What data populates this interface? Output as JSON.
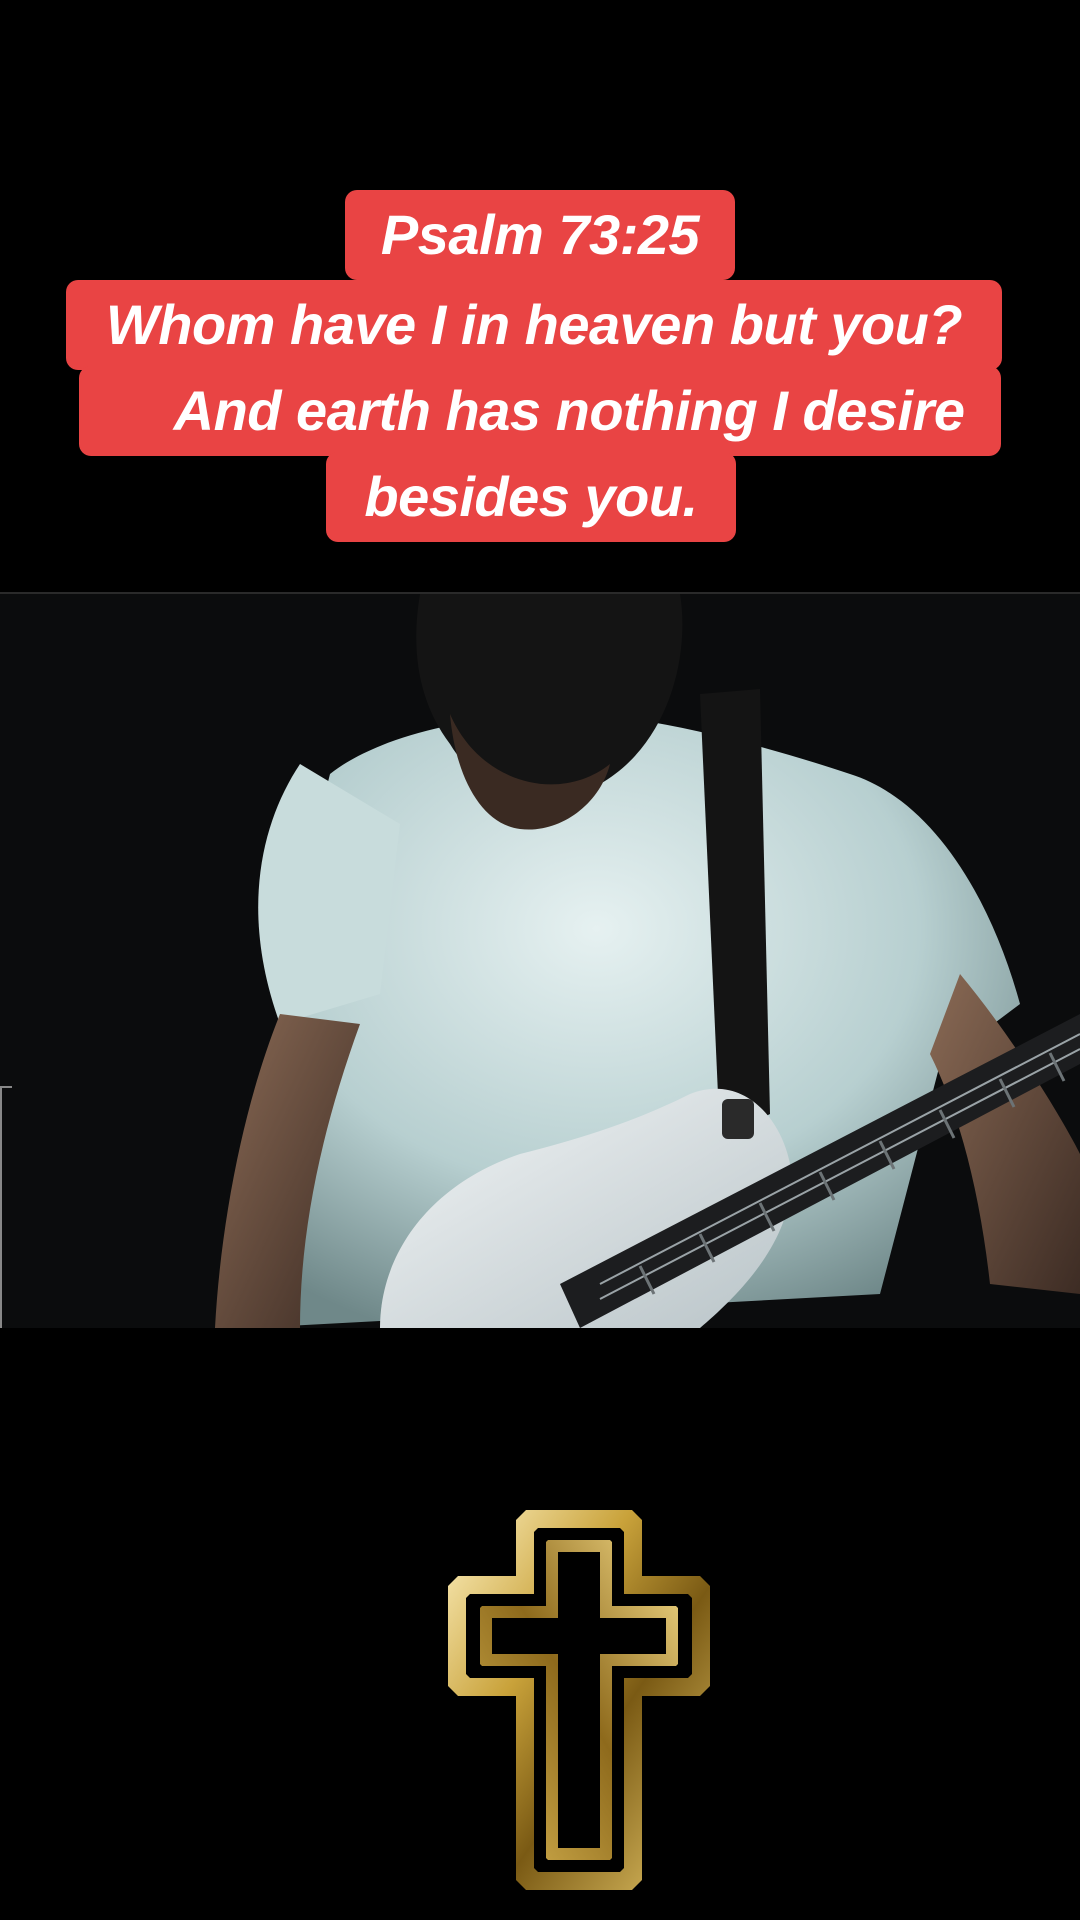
{
  "caption": {
    "lines": [
      "Psalm 73:25",
      "Whom have I in heaven but you?",
      "    And earth has nothing I desire",
      "besides you."
    ]
  },
  "video": {
    "description_icon": "guitar-player-video"
  },
  "colors": {
    "caption_bg": "#e94444",
    "caption_text": "#ffffff",
    "background": "#000000",
    "cross_gold": "#c9a23a"
  },
  "icons": {
    "cross": "cross-icon"
  }
}
